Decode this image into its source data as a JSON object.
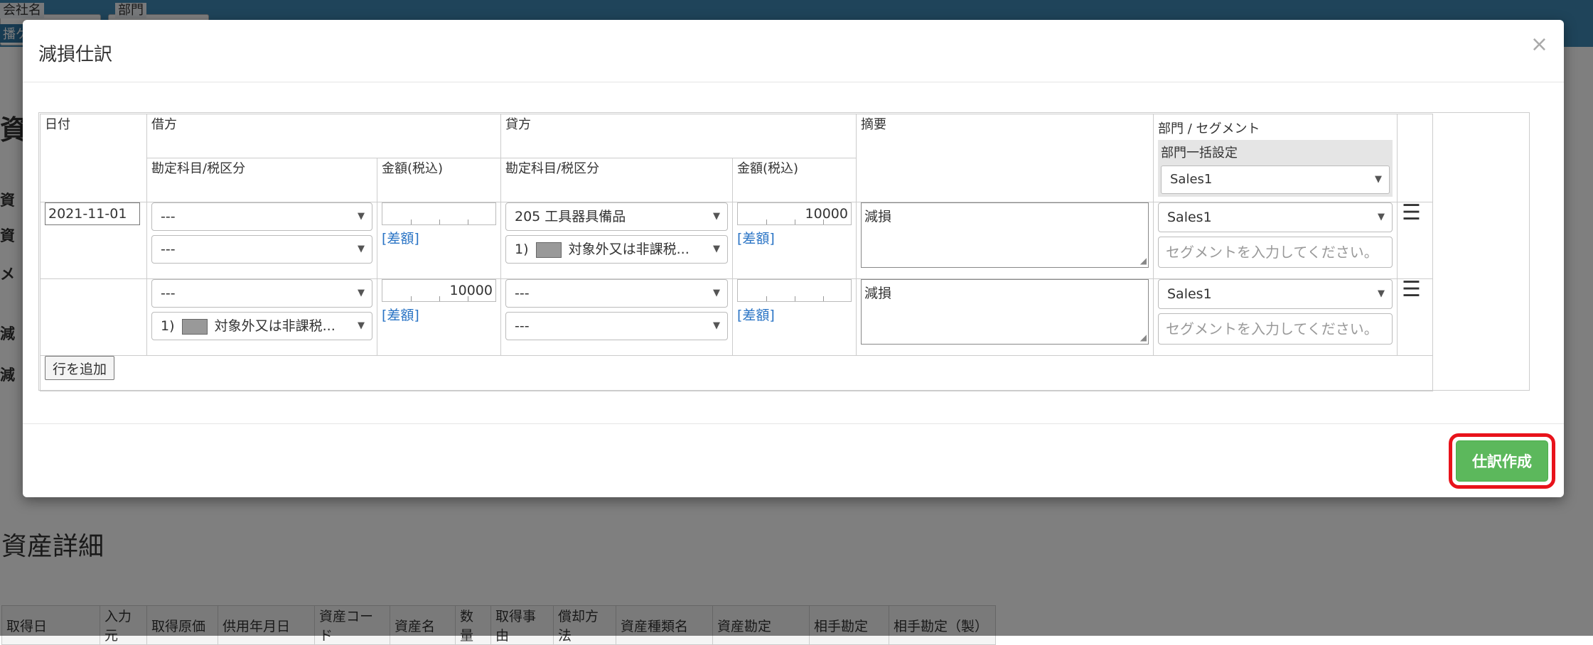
{
  "background": {
    "company_label": "会社名",
    "company_value": "播ケ",
    "department_label": "部門",
    "page_title_fragment": "資",
    "left_labels": [
      "資",
      "資",
      "メ",
      "減",
      "減"
    ],
    "section_title": "資産詳細",
    "table_headers": [
      "取得日",
      "入力元",
      "取得原価",
      "供用年月日",
      "資産コード",
      "資産名",
      "数量",
      "取得事由",
      "償却方法",
      "資産種類名",
      "資産勘定",
      "相手勘定",
      "相手勘定（製）"
    ]
  },
  "modal": {
    "title": "減損仕訳",
    "close_icon": "×",
    "create_button": "仕訳作成",
    "add_row_button": "行を追加"
  },
  "journal": {
    "headers": {
      "date": "日付",
      "debit": "借方",
      "credit": "貸方",
      "debit_account": "勘定科目/税区分",
      "debit_amount": "金額(税込)",
      "credit_account": "勘定科目/税区分",
      "credit_amount": "金額(税込)",
      "memo": "摘要",
      "dept_segment": "部門 / セグメント",
      "dept_bulk_label": "部門一括設定",
      "dept_bulk_value": "Sales1"
    },
    "diff_link": "[差額]",
    "segment_placeholder": "セグメントを入力してください。",
    "rows": [
      {
        "date": "2021-11-01",
        "debit_account": "---",
        "debit_tax_prefix": "---",
        "debit_tax_suffix": "",
        "debit_amount": "",
        "credit_account": "205 工具器具備品",
        "credit_tax_prefix": "1)",
        "credit_tax_suffix": "対象外又は非課税...",
        "credit_amount": "10000",
        "memo": "減損",
        "department": "Sales1"
      },
      {
        "date": "",
        "debit_account": "---",
        "debit_tax_prefix": "1)",
        "debit_tax_suffix": "対象外又は非課税...",
        "debit_amount": "10000",
        "credit_account": "---",
        "credit_tax_prefix": "---",
        "credit_tax_suffix": "",
        "credit_amount": "",
        "memo": "減損",
        "department": "Sales1"
      }
    ]
  }
}
